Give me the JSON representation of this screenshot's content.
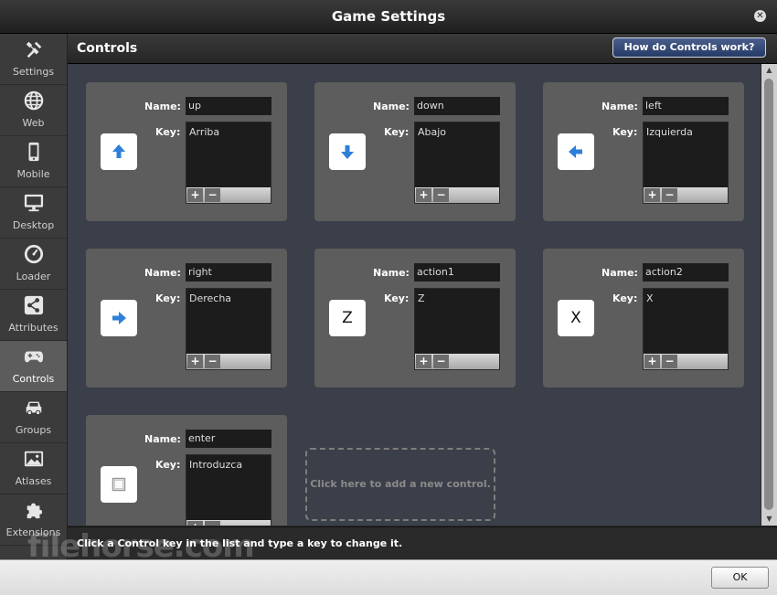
{
  "window": {
    "title": "Game Settings",
    "close_icon": "close-icon"
  },
  "sidebar": {
    "items": [
      {
        "label": "Settings",
        "icon": "wrench-icon"
      },
      {
        "label": "Web",
        "icon": "globe-icon"
      },
      {
        "label": "Mobile",
        "icon": "mobile-icon"
      },
      {
        "label": "Desktop",
        "icon": "monitor-icon"
      },
      {
        "label": "Loader",
        "icon": "gauge-icon"
      },
      {
        "label": "Attributes",
        "icon": "share-icon"
      },
      {
        "label": "Controls",
        "icon": "gamepad-icon",
        "active": true
      },
      {
        "label": "Groups",
        "icon": "car-icon"
      },
      {
        "label": "Atlases",
        "icon": "image-icon"
      },
      {
        "label": "Extensions",
        "icon": "puzzle-icon"
      }
    ]
  },
  "header": {
    "title": "Controls",
    "help_button": "How do Controls work?"
  },
  "labels": {
    "name": "Name:",
    "key": "Key:",
    "add": "+",
    "remove": "−"
  },
  "controls": [
    {
      "name": "up",
      "key": "Arriba",
      "glyph": "arrow-up"
    },
    {
      "name": "down",
      "key": "Abajo",
      "glyph": "arrow-down"
    },
    {
      "name": "left",
      "key": "Izquierda",
      "glyph": "arrow-left"
    },
    {
      "name": "right",
      "key": "Derecha",
      "glyph": "arrow-right"
    },
    {
      "name": "action1",
      "key": "Z",
      "glyph": "Z"
    },
    {
      "name": "action2",
      "key": "X",
      "glyph": "X"
    },
    {
      "name": "enter",
      "key": "Introduzca",
      "glyph": "square"
    }
  ],
  "add_control": "Click here to add a new control.",
  "status": "Click a Control key in the list and type a key to change it.",
  "footer": {
    "ok": "OK"
  },
  "watermark": "filehorse.com",
  "colors": {
    "accent_blue": "#2e7fd8",
    "help_button": "#2d4270"
  }
}
